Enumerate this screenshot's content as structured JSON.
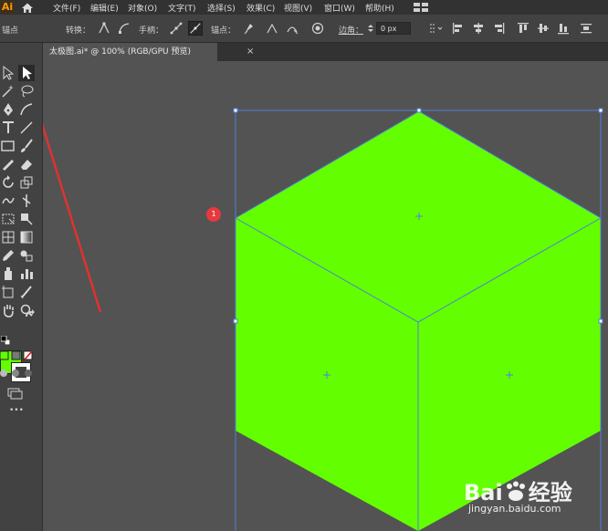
{
  "app": {
    "logo": "Ai"
  },
  "menus": [
    "文件(F)",
    "编辑(E)",
    "对象(O)",
    "文字(T)",
    "选择(S)",
    "效果(C)",
    "视图(V)",
    "窗口(W)",
    "帮助(H)"
  ],
  "control_bar": {
    "anchor_label": "锚点",
    "convert_label": "转换：",
    "handles_label": "手柄：",
    "anchors_label": "锚点：",
    "corners_label": "边角：",
    "corner_radius_value": "0 px"
  },
  "document": {
    "tab_title": "太极图.ai* @ 100% (RGB/GPU 预览)",
    "close_glyph": "×"
  },
  "colors": {
    "fill": "#63ff00",
    "selection": "#4f7fd9",
    "arrow": "#e0322f",
    "badge": "#e6393e"
  },
  "annotation": {
    "badge_number": "1"
  },
  "toolbox": {
    "more_label": "•••"
  },
  "watermark": {
    "brand_a": "Bai",
    "brand_b": "经验",
    "url": "jingyan.baidu.com"
  }
}
